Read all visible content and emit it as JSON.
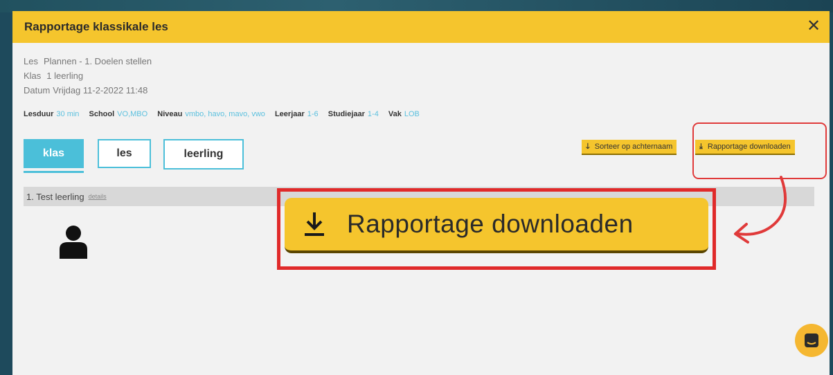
{
  "modal": {
    "title": "Rapportage klassikale les",
    "close_label": "✕"
  },
  "meta": {
    "les_key": "Les",
    "les_value": "Plannen - 1. Doelen stellen",
    "klas_key": "Klas",
    "klas_value": "1 leerling",
    "datum_key": "Datum",
    "datum_value": "Vrijdag 11-2-2022 11:48"
  },
  "attributes": [
    {
      "key": "Lesduur",
      "value": "30 min"
    },
    {
      "key": "School",
      "value": "VO,MBO"
    },
    {
      "key": "Niveau",
      "value": "vmbo, havo, mavo, vwo"
    },
    {
      "key": "Leerjaar",
      "value": "1-6"
    },
    {
      "key": "Studiejaar",
      "value": "1-4"
    },
    {
      "key": "Vak",
      "value": "LOB"
    }
  ],
  "tabs": [
    {
      "label": "klas",
      "active": true
    },
    {
      "label": "les",
      "active": false
    },
    {
      "label": "leerling",
      "active": false
    }
  ],
  "toolbar": {
    "sort_label": "Sorteer op achternaam",
    "download_label": "Rapportage downloaden",
    "download_icon": "download-icon",
    "sort_icon": "arrow-down-icon"
  },
  "students": [
    {
      "name": "1. Test leerling",
      "details_label": "details"
    }
  ],
  "callout": {
    "label": "Rapportage downloaden",
    "icon": "download-icon"
  },
  "colors": {
    "accent_yellow": "#f5c52d",
    "accent_cyan": "#4bbfd9",
    "highlight_red": "#e02a2a"
  }
}
